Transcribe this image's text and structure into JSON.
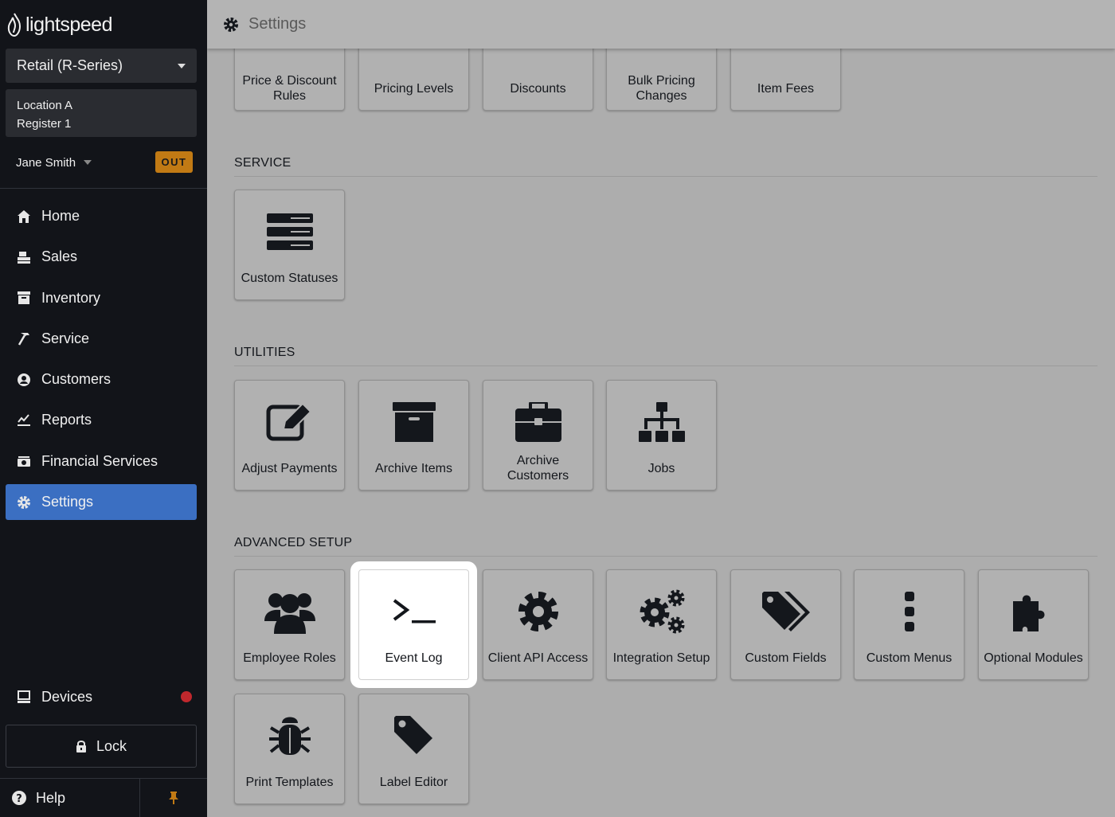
{
  "app": {
    "brand": "lightspeed"
  },
  "sidebar": {
    "store_selector": "Retail (R-Series)",
    "location": "Location A",
    "register": "Register 1",
    "user_name": "Jane Smith",
    "clock_status": "OUT",
    "nav": [
      {
        "label": "Home",
        "icon": "home-icon"
      },
      {
        "label": "Sales",
        "icon": "sales-icon"
      },
      {
        "label": "Inventory",
        "icon": "inventory-icon"
      },
      {
        "label": "Service",
        "icon": "hammer-icon"
      },
      {
        "label": "Customers",
        "icon": "user-circle-icon"
      },
      {
        "label": "Reports",
        "icon": "chart-icon"
      },
      {
        "label": "Financial Services",
        "icon": "money-icon"
      },
      {
        "label": "Settings",
        "icon": "gear-icon"
      }
    ],
    "active_nav": "Settings",
    "devices_label": "Devices",
    "lock_label": "Lock",
    "help_label": "Help"
  },
  "header": {
    "title": "Settings"
  },
  "sections": {
    "pricing_tiles": [
      "Price & Discount Rules",
      "Pricing Levels",
      "Discounts",
      "Bulk Pricing Changes",
      "Item Fees"
    ],
    "service": {
      "title": "SERVICE",
      "tiles": [
        "Custom Statuses"
      ]
    },
    "utilities": {
      "title": "UTILITIES",
      "tiles": [
        "Adjust Payments",
        "Archive Items",
        "Archive Customers",
        "Jobs"
      ]
    },
    "advanced": {
      "title": "ADVANCED SETUP",
      "tiles": [
        "Employee Roles",
        "Event Log",
        "Client API Access",
        "Integration Setup",
        "Custom Fields",
        "Custom Menus",
        "Optional Modules",
        "Print Templates",
        "Label Editor"
      ]
    }
  },
  "colors": {
    "sidebar_bg": "#121419",
    "active_nav": "#3b6fc2",
    "out_badge": "#c17a14",
    "alert_dot": "#c0282d"
  }
}
